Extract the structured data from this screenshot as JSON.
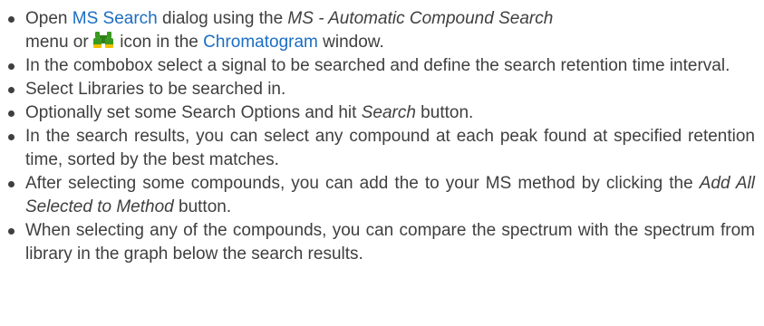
{
  "steps": [
    {
      "pre": "Open ",
      "link1": "MS Search",
      "mid": " dialog using the ",
      "menu": "MS - Automatic Compound Search",
      "line2_pre": "menu or ",
      "icon": "binoculars-icon",
      "post_icon": " icon in the ",
      "link2": "Chromatogram",
      "end": " window."
    },
    {
      "text": "In the combobox select a signal to be searched and define the search retention time interval."
    },
    {
      "text": "Select Libraries to be searched in."
    },
    {
      "pre": "Optionally set some Search Options and hit ",
      "em": "Search",
      "post": " button."
    },
    {
      "text": "In the search results, you can select any compound at each peak found at specified retention time, sorted by the best matches."
    },
    {
      "pre": "After selecting some compounds, you can add the to your MS method by clicking the ",
      "em": "Add All Selected to Method",
      "post": " button."
    },
    {
      "text": "When selecting any of the compounds, you can compare the spectrum with the spectrum from library in the graph below the search results."
    }
  ],
  "colors": {
    "text": "#3f3f3f",
    "link": "#1b6ec2",
    "icon_green": "#3a9a1f",
    "icon_yellow": "#f2c200"
  }
}
